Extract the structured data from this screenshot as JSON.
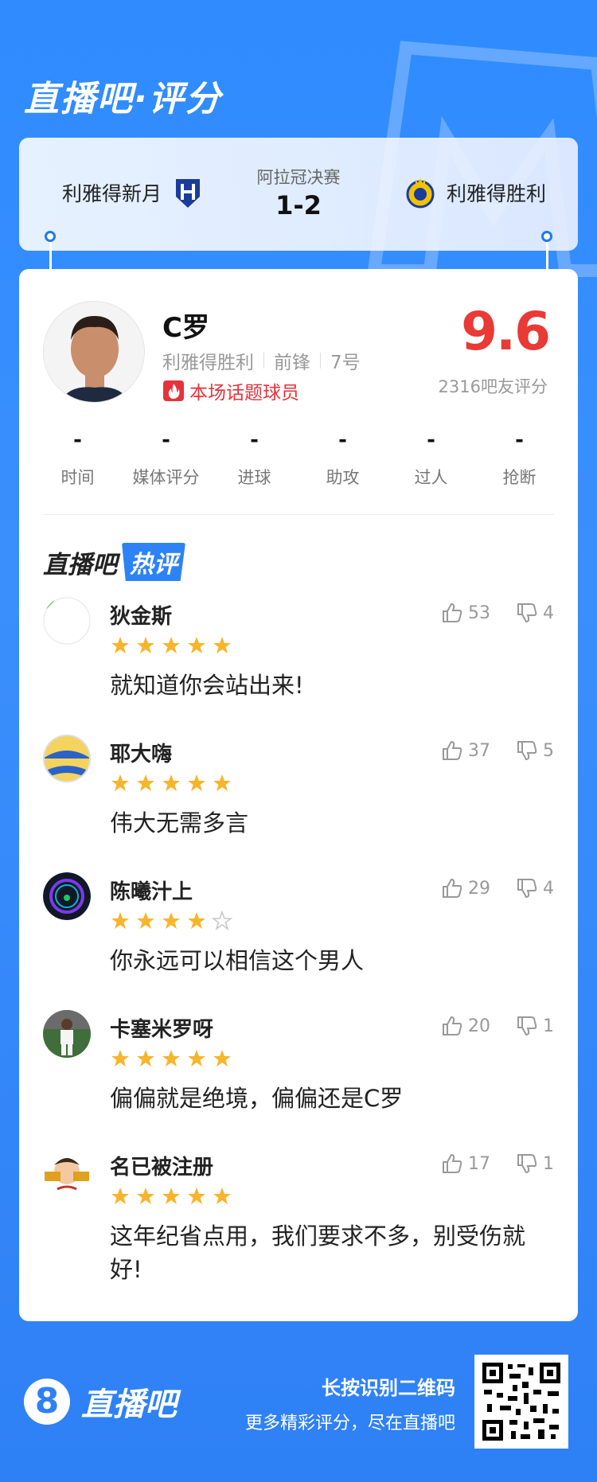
{
  "header": {
    "brand_title": "直播吧·评分"
  },
  "match": {
    "competition": "阿拉冠决赛",
    "score": "1-2",
    "home_team": "利雅得新月",
    "away_team": "利雅得胜利"
  },
  "player": {
    "name": "C罗",
    "team": "利雅得胜利",
    "position": "前锋",
    "number": "7号",
    "hot_tag": "本场话题球员",
    "rating": "9.6",
    "rating_count": "2316吧友评分"
  },
  "stats": [
    {
      "value": "-",
      "label": "时间"
    },
    {
      "value": "-",
      "label": "媒体评分"
    },
    {
      "value": "-",
      "label": "进球"
    },
    {
      "value": "-",
      "label": "助攻"
    },
    {
      "value": "-",
      "label": "过人"
    },
    {
      "value": "-",
      "label": "抢断"
    }
  ],
  "hot_comments": {
    "title_a": "直播吧",
    "title_b": "热评",
    "items": [
      {
        "user": "狄金斯",
        "stars": 5,
        "text": "就知道你会站出来!",
        "likes": "53",
        "dislikes": "4"
      },
      {
        "user": "耶大嗨",
        "stars": 5,
        "text": "伟大无需多言",
        "likes": "37",
        "dislikes": "5"
      },
      {
        "user": "陈曦汁上",
        "stars": 4,
        "text": "你永远可以相信这个男人",
        "likes": "29",
        "dislikes": "4"
      },
      {
        "user": "卡塞米罗呀",
        "stars": 5,
        "text": "偏偏就是绝境，偏偏还是C罗",
        "likes": "20",
        "dislikes": "1"
      },
      {
        "user": "名已被注册",
        "stars": 5,
        "text": "这年纪省点用，我们要求不多，别受伤就好!",
        "likes": "17",
        "dislikes": "1"
      }
    ]
  },
  "footer": {
    "logo_badge": "8",
    "logo_name": "直播吧",
    "qr_hint": "长按识别二维码",
    "qr_sub": "更多精彩评分，尽在直播吧"
  },
  "colors": {
    "accent": "#2e80f5",
    "rating": "#e93a36",
    "star": "#f7b52c"
  }
}
